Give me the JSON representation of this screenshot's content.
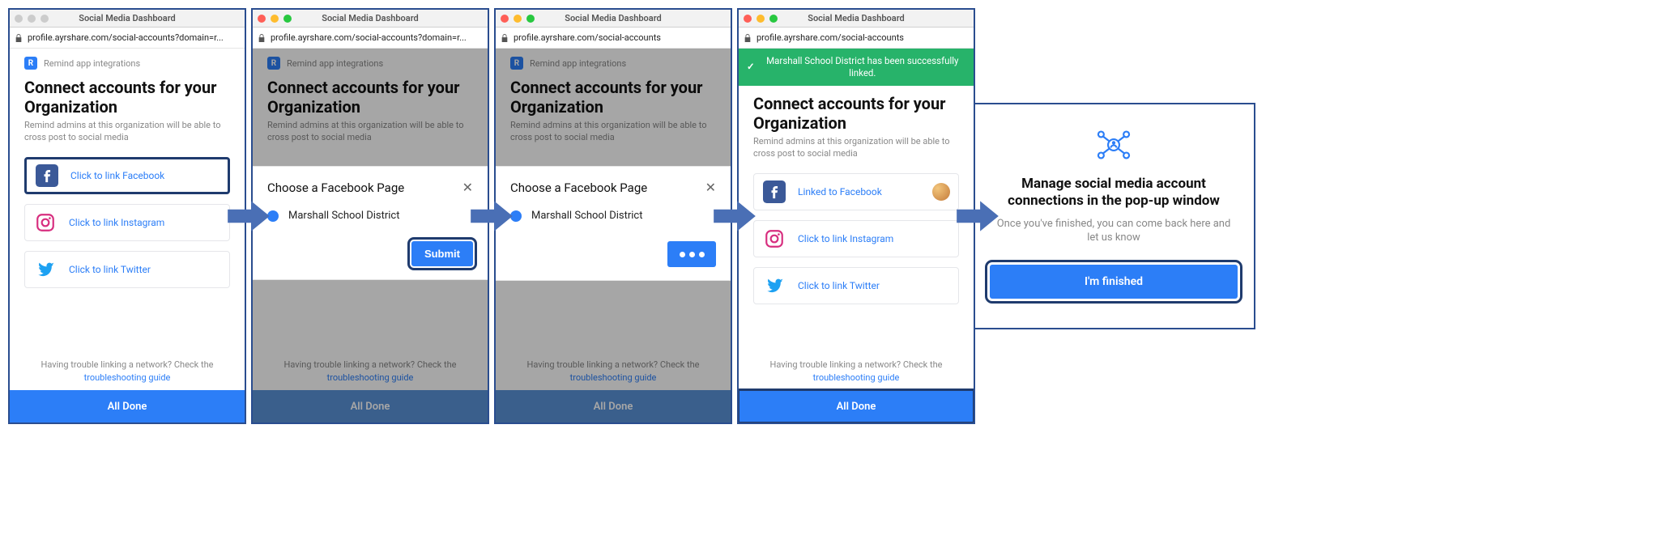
{
  "window_title": "Social Media Dashboard",
  "url_full": "profile.ayrshare.com/social-accounts?domain=r...",
  "url_short": "profile.ayrshare.com/social-accounts",
  "brand_label": "Remind app integrations",
  "heading": "Connect accounts for your Organization",
  "subheading": "Remind admins at this organization will be able to cross post to social media",
  "social": {
    "facebook_link": "Click to link Facebook",
    "facebook_linked": "Linked to Facebook",
    "instagram_link": "Click to link Instagram",
    "twitter_link": "Click to link Twitter"
  },
  "trouble_prefix": "Having trouble linking a network? Check the ",
  "trouble_link": "troubleshooting guide",
  "alldone": "All Done",
  "modal": {
    "title": "Choose a Facebook Page",
    "option": "Marshall School District",
    "submit": "Submit"
  },
  "toast": "Marshall School District has been successfully linked.",
  "final": {
    "title": "Manage social media account connections in the pop-up window",
    "sub": "Once you've finished, you can come back here and let us know",
    "btn": "I'm finished"
  }
}
